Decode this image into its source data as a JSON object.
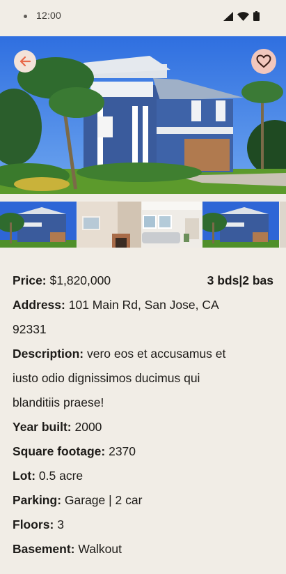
{
  "status_bar": {
    "time": "12:00",
    "icons": [
      "signal-icon",
      "wifi-icon",
      "battery-icon"
    ]
  },
  "hero": {
    "image": "house-photo",
    "back_icon": "arrow-back-icon",
    "favorite_icon": "heart-outline-icon"
  },
  "thumbnails": [
    "house-exterior-thumb",
    "living-room-fireplace-thumb",
    "living-room-sofa-thumb",
    "house-exterior-thumb",
    "partial-thumb"
  ],
  "details": {
    "price_label": "Price:",
    "price_value": "$1,820,000",
    "beds_baths": "3 bds|2 bas",
    "address_label": "Address:",
    "address_value": "101 Main Rd, San Jose, CA",
    "address_zip": "92331",
    "description_label": "Description:",
    "description_line1": "vero eos et accusamus et",
    "description_line2": "iusto odio dignissimos ducimus qui",
    "description_line3": "blanditiis praese!",
    "year_label": "Year built:",
    "year_value": "2000",
    "sqft_label": "Square footage:",
    "sqft_value": "2370",
    "lot_label": "Lot:",
    "lot_value": "0.5 acre",
    "parking_label": "Parking:",
    "parking_value": "Garage | 2 car",
    "floors_label": "Floors:",
    "floors_value": "3",
    "basement_label": "Basement:",
    "basement_value": "Walkout"
  },
  "colors": {
    "background": "#f1ede6",
    "back_button": "#f3e3d9",
    "back_arrow": "#e8694a",
    "fav_button": "#f2c7bd",
    "fav_icon": "#3b1f19"
  }
}
